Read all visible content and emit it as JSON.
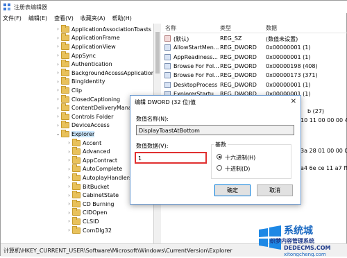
{
  "titlebar": {
    "title": "注册表编辑器"
  },
  "menu": [
    "文件(F)",
    "编辑(E)",
    "查看(V)",
    "收藏夹(A)",
    "帮助(H)"
  ],
  "tree": [
    {
      "label": "ApplicationAssociationToasts",
      "level": 0
    },
    {
      "label": "ApplicationFrame",
      "level": 0
    },
    {
      "label": "ApplicationView",
      "level": 0
    },
    {
      "label": "AppSync",
      "level": 0
    },
    {
      "label": "Authentication",
      "level": 0
    },
    {
      "label": "BackgroundAccessApplications",
      "level": 0
    },
    {
      "label": "BingIdentity",
      "level": 0
    },
    {
      "label": "Clip",
      "level": 0
    },
    {
      "label": "ClosedCaptioning",
      "level": 0
    },
    {
      "label": "ContentDeliveryManag",
      "level": 0
    },
    {
      "label": "Controls Folder",
      "level": 0
    },
    {
      "label": "DeviceAccess",
      "level": 0
    },
    {
      "label": "Explorer",
      "level": 0,
      "selected": true,
      "expanded": true
    },
    {
      "label": "Accent",
      "level": 1
    },
    {
      "label": "Advanced",
      "level": 1
    },
    {
      "label": "AppContract",
      "level": 1
    },
    {
      "label": "AutoComplete",
      "level": 1
    },
    {
      "label": "AutoplayHandlers",
      "level": 1
    },
    {
      "label": "BitBucket",
      "level": 1
    },
    {
      "label": "CabinetState",
      "level": 1
    },
    {
      "label": "CD Burning",
      "level": 1
    },
    {
      "label": "CIDOpen",
      "level": 1
    },
    {
      "label": "CLSID",
      "level": 1
    },
    {
      "label": "ComDlg32",
      "level": 1
    }
  ],
  "list": {
    "headers": {
      "name": "名称",
      "type": "类型",
      "data": "数据"
    },
    "rows": [
      {
        "name": "(默认)",
        "type": "REG_SZ",
        "data": "(数值未设置)",
        "kind": "sz"
      },
      {
        "name": "AllowStartMen...",
        "type": "REG_DWORD",
        "data": "0x00000001 (1)",
        "kind": "dw"
      },
      {
        "name": "AppReadiness...",
        "type": "REG_DWORD",
        "data": "0x00000001 (1)",
        "kind": "dw"
      },
      {
        "name": "Browse For Fol...",
        "type": "REG_DWORD",
        "data": "0x00000198 (408)",
        "kind": "dw"
      },
      {
        "name": "Browse For Fol...",
        "type": "REG_DWORD",
        "data": "0x00000173 (371)",
        "kind": "dw"
      },
      {
        "name": "DesktopProcess",
        "type": "REG_DWORD",
        "data": "0x00000001 (1)",
        "kind": "dw"
      },
      {
        "name": "ExplorerStartu...",
        "type": "REG_DWORD",
        "data": "0x00000001 (1)",
        "kind": "dw"
      }
    ],
    "partial": [
      "b (27)",
      "10 11 00 00 00 42 0",
      "3a 28 01 00 00 00",
      "a4 6e ce 11 a7 ff"
    ]
  },
  "dialog": {
    "title": "编辑 DWORD (32 位)值",
    "name_label": "数值名称(N):",
    "name_value": "DisplayToastAtBottom",
    "data_label": "数值数据(V):",
    "data_value": "1",
    "base_label": "基数",
    "hex_label": "十六进制(H)",
    "dec_label": "十进制(D)",
    "ok": "确定",
    "cancel": "取消"
  },
  "status": "计算机\\HKEY_CURRENT_USER\\Software\\Microsoft\\Windows\\CurrentVersion\\Explorer",
  "watermark": {
    "brand": "系统城",
    "line1": "织梦内容管理系统",
    "line2": "DEDECMS.COM",
    "line3": "xitongcheng.com"
  }
}
